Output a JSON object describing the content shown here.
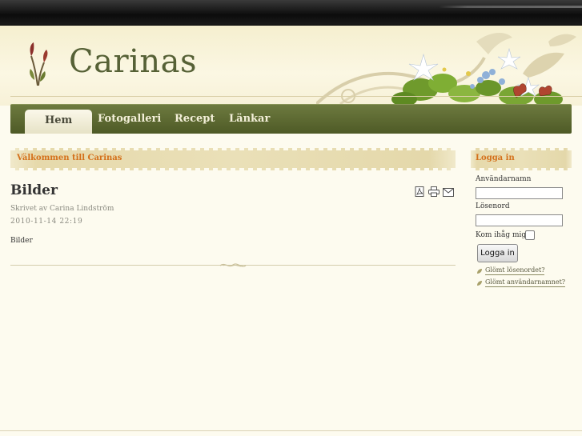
{
  "site": {
    "title": "Carinas"
  },
  "nav": {
    "items": [
      "Hem",
      "Fotogalleri",
      "Recept",
      "Länkar"
    ],
    "active": "Hem"
  },
  "welcome": {
    "text": "Välkommen till Carinas"
  },
  "article": {
    "title": "Bilder",
    "author": "Skrivet av Carina Lindström",
    "date": "2010-11-14 22:19",
    "body": "Bilder",
    "action_icons": [
      "pdf-icon",
      "print-icon",
      "email-icon"
    ]
  },
  "login": {
    "heading": "Logga in",
    "username_label": "Användarnamn",
    "username_value": "",
    "password_label": "Lösenord",
    "password_value": "",
    "remember_label": "Kom ihåg mig",
    "remember_checked": false,
    "button": "Logga in",
    "forgot_password": "Glömt lösenordet?",
    "forgot_username": "Glömt användarnamnet?"
  },
  "colors": {
    "nav": "#5e6a30",
    "accent": "#d4701a",
    "title": "#566136"
  }
}
